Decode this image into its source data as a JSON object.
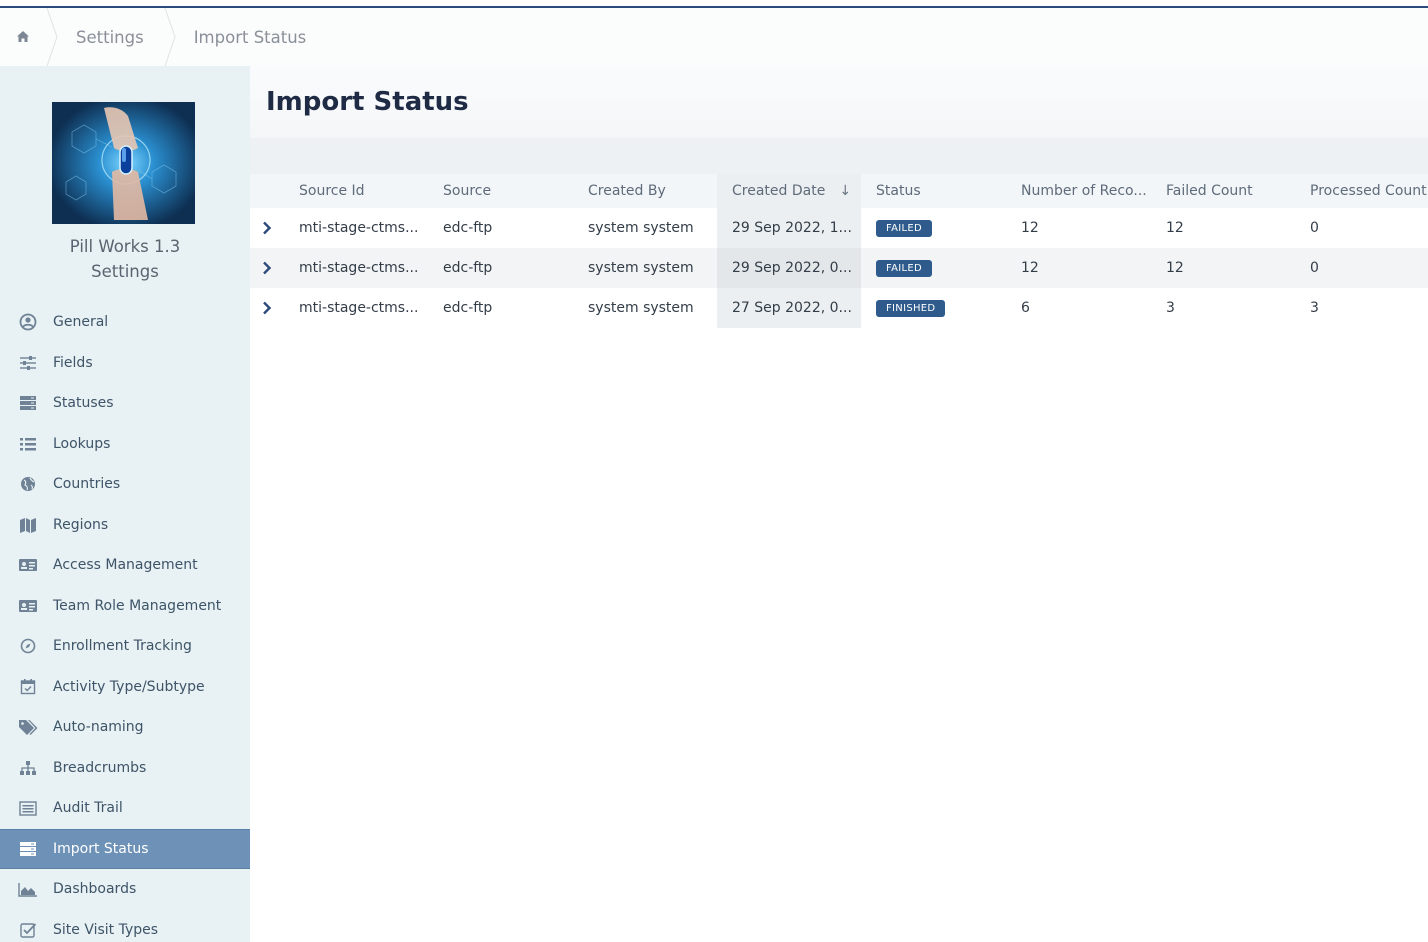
{
  "breadcrumb": {
    "items": [
      {
        "label": "Settings"
      },
      {
        "label": "Import Status"
      }
    ]
  },
  "sidebar": {
    "app_name_line1": "Pill Works 1.3",
    "app_name_line2": "Settings",
    "items": [
      {
        "label": "General",
        "icon": "user-circle-icon"
      },
      {
        "label": "Fields",
        "icon": "sliders-icon"
      },
      {
        "label": "Statuses",
        "icon": "server-icon"
      },
      {
        "label": "Lookups",
        "icon": "list-icon"
      },
      {
        "label": "Countries",
        "icon": "globe-icon"
      },
      {
        "label": "Regions",
        "icon": "map-icon"
      },
      {
        "label": "Access Management",
        "icon": "id-card-icon"
      },
      {
        "label": "Team Role Management",
        "icon": "id-card-icon"
      },
      {
        "label": "Enrollment Tracking",
        "icon": "compass-icon"
      },
      {
        "label": "Activity Type/Subtype",
        "icon": "calendar-check-icon"
      },
      {
        "label": "Auto-naming",
        "icon": "tags-icon"
      },
      {
        "label": "Breadcrumbs",
        "icon": "sitemap-icon"
      },
      {
        "label": "Audit Trail",
        "icon": "list-alt-icon"
      },
      {
        "label": "Import Status",
        "icon": "server-icon",
        "active": true
      },
      {
        "label": "Dashboards",
        "icon": "area-chart-icon"
      },
      {
        "label": "Site Visit Types",
        "icon": "check-square-icon"
      }
    ]
  },
  "page": {
    "title": "Import Status"
  },
  "table": {
    "columns": [
      "Source Id",
      "Source",
      "Created By",
      "Created Date",
      "Status",
      "Number of Reco...",
      "Failed Count",
      "Processed Count"
    ],
    "sorted_column": "Created Date",
    "rows": [
      {
        "source_id": "mti-stage-ctms...",
        "source": "edc-ftp",
        "created_by": "system system",
        "created_date": "29 Sep 2022, 1...",
        "status": "FAILED",
        "num_records": "12",
        "failed": "12",
        "processed": "0"
      },
      {
        "source_id": "mti-stage-ctms...",
        "source": "edc-ftp",
        "created_by": "system system",
        "created_date": "29 Sep 2022, 0...",
        "status": "FAILED",
        "num_records": "12",
        "failed": "12",
        "processed": "0"
      },
      {
        "source_id": "mti-stage-ctms...",
        "source": "edc-ftp",
        "created_by": "system system",
        "created_date": "27 Sep 2022, 0...",
        "status": "FINISHED",
        "num_records": "6",
        "failed": "3",
        "processed": "3"
      }
    ]
  },
  "colors": {
    "accent": "#2d4a7a",
    "active_menu": "#6d91b7",
    "badge": "#2f5b8c",
    "sidebar_bg": "#e8f1f3"
  }
}
